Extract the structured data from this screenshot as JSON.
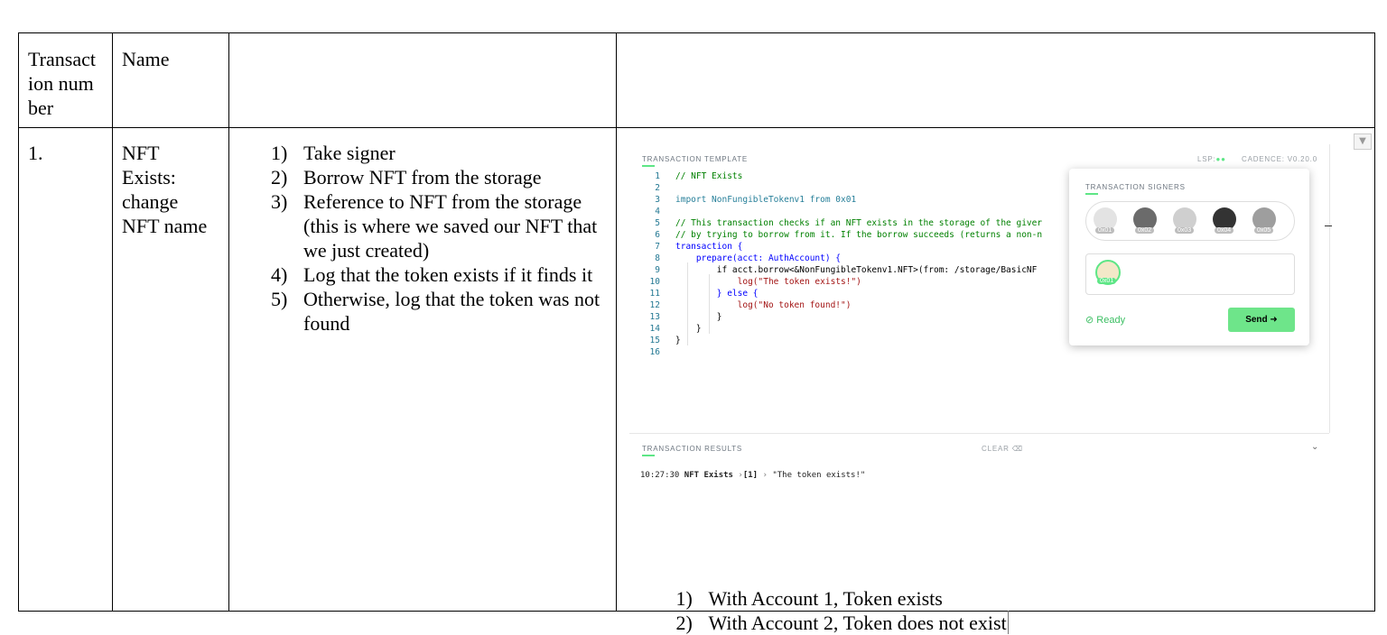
{
  "table": {
    "headers": [
      "Transact ion number",
      "Name",
      "",
      ""
    ],
    "row": {
      "number": "1.",
      "name": "NFT Exists: change NFT name",
      "steps": [
        {
          "num": "1)",
          "text": "Take signer"
        },
        {
          "num": "2)",
          "text": "Borrow NFT from the storage"
        },
        {
          "num": "3)",
          "text": "Reference to NFT from the storage (this is where we saved our NFT that we just created)"
        },
        {
          "num": "4)",
          "text": "Log that the token exists if it finds it"
        },
        {
          "num": "5)",
          "text": "Otherwise, log that the token was not found"
        }
      ],
      "results_notes": [
        {
          "num": "1)",
          "text": "With Account 1, Token exists"
        },
        {
          "num": "2)",
          "text": "With Account 2, Token does not exist"
        }
      ]
    }
  },
  "screenshot": {
    "template_header": "TRANSACTION TEMPLATE",
    "lsp_label": "LSP:",
    "cadence_label": "CADENCE: V0.20.0",
    "code_lines": [
      {
        "n": "1",
        "t": "// NFT Exists"
      },
      {
        "n": "2",
        "t": ""
      },
      {
        "n": "3",
        "t": "import NonFungibleTokenv1 from 0x01"
      },
      {
        "n": "4",
        "t": ""
      },
      {
        "n": "5",
        "t": "// This transaction checks if an NFT exists in the storage of the giver"
      },
      {
        "n": "6",
        "t": "// by trying to borrow from it. If the borrow succeeds (returns a non-n"
      },
      {
        "n": "7",
        "t": "transaction {"
      },
      {
        "n": "8",
        "t": "    prepare(acct: AuthAccount) {"
      },
      {
        "n": "9",
        "t": "        if acct.borrow<&NonFungibleTokenv1.NFT>(from: /storage/BasicNF"
      },
      {
        "n": "10",
        "t": "            log(\"The token exists!\")"
      },
      {
        "n": "11",
        "t": "        } else {"
      },
      {
        "n": "12",
        "t": "            log(\"No token found!\")"
      },
      {
        "n": "13",
        "t": "        }"
      },
      {
        "n": "14",
        "t": "    }"
      },
      {
        "n": "15",
        "t": "}"
      },
      {
        "n": "16",
        "t": ""
      }
    ],
    "signers_header": "TRANSACTION SIGNERS",
    "accounts": [
      "0x01",
      "0x02",
      "0x03",
      "0x04",
      "0x05"
    ],
    "selected_account": "0x01",
    "status": "Ready",
    "send_label": "Send",
    "results_header": "TRANSACTION RESULTS",
    "clear_label": "CLEAR",
    "result_time": "10:27:30",
    "result_name": "NFT Exists",
    "result_index": "[1]",
    "result_message": "\"The token exists!\"",
    "colors": {
      "accent_green": "#5ee686",
      "send_button": "#6ee58a"
    }
  }
}
